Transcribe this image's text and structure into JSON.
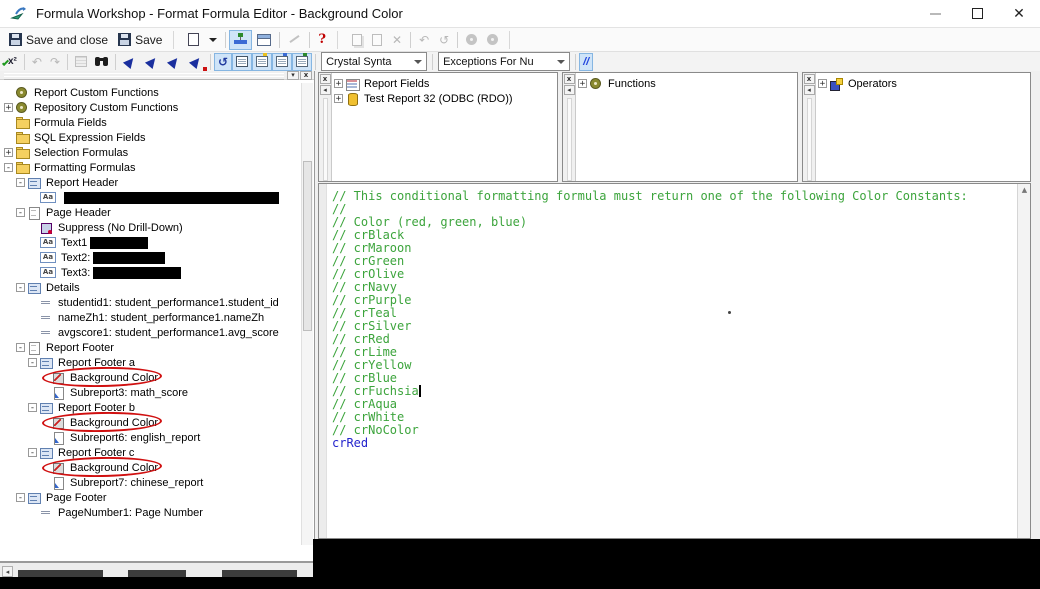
{
  "window": {
    "title": "Formula Workshop - Format Formula Editor - Background Color"
  },
  "toolbar_main": {
    "save_and_close": "Save and close",
    "save": "Save",
    "help": "?"
  },
  "toolbar_formula": {
    "check_label": "x²",
    "syntax_selector": {
      "value": "Crystal Synta"
    },
    "exceptions_selector": {
      "value": "Exceptions For Nu"
    },
    "comment_label": "//"
  },
  "icon_glyphs": {
    "text_object": "Aa",
    "undo": "↶",
    "redo": "↷",
    "refresh": "↺",
    "delete": "✕",
    "close_small": "x",
    "collapse_chevron": "▾",
    "left_arrow": "◂",
    "up_arrow": "▲",
    "close_window": "✕"
  },
  "workshop_tree": {
    "items": [
      {
        "label": "Report Custom Functions",
        "level": 0,
        "expander": "",
        "icon": "gear"
      },
      {
        "label": "Repository Custom Functions",
        "level": 0,
        "expander": "plus",
        "icon": "gear"
      },
      {
        "label": "Formula Fields",
        "level": 0,
        "expander": "",
        "icon": "folder"
      },
      {
        "label": "SQL Expression Fields",
        "level": 0,
        "expander": "",
        "icon": "folder"
      },
      {
        "label": "Selection Formulas",
        "level": 0,
        "expander": "plus",
        "icon": "folder"
      },
      {
        "label": "Formatting Formulas",
        "level": 0,
        "expander": "minus",
        "icon": "folder"
      },
      {
        "label": "Report Header",
        "level": 1,
        "expander": "minus",
        "icon": "section"
      },
      {
        "label": "",
        "level": 2,
        "expander": "",
        "icon": "text",
        "redact": 215
      },
      {
        "label": "Page Header",
        "level": 1,
        "expander": "minus",
        "icon": "page"
      },
      {
        "label": "Suppress (No Drill-Down)",
        "level": 2,
        "expander": "",
        "icon": "suppress"
      },
      {
        "label": "Text1",
        "level": 2,
        "expander": "",
        "icon": "text",
        "redact": 58
      },
      {
        "label": "Text2:",
        "level": 2,
        "expander": "",
        "icon": "text",
        "redact": 72
      },
      {
        "label": "Text3:",
        "level": 2,
        "expander": "",
        "icon": "text",
        "redact": 88
      },
      {
        "label": "Details",
        "level": 1,
        "expander": "minus",
        "icon": "section"
      },
      {
        "label": "studentid1: student_performance1.student_id",
        "level": 2,
        "expander": "",
        "icon": "dash"
      },
      {
        "label": "nameZh1: student_performance1.nameZh",
        "level": 2,
        "expander": "",
        "icon": "dash"
      },
      {
        "label": "avgscore1: student_performance1.avg_score",
        "level": 2,
        "expander": "",
        "icon": "dash"
      },
      {
        "label": "Report Footer",
        "level": 1,
        "expander": "minus",
        "icon": "page"
      },
      {
        "label": "Report Footer a",
        "level": 2,
        "expander": "minus",
        "icon": "section"
      },
      {
        "label": "Background Color",
        "level": 3,
        "expander": "",
        "icon": "format",
        "circled": true
      },
      {
        "label": "Subreport3: math_score",
        "level": 3,
        "expander": "",
        "icon": "subreport"
      },
      {
        "label": "Report Footer b",
        "level": 2,
        "expander": "minus",
        "icon": "section"
      },
      {
        "label": "Background Color",
        "level": 3,
        "expander": "",
        "icon": "format",
        "circled": true
      },
      {
        "label": "Subreport6: english_report",
        "level": 3,
        "expander": "",
        "icon": "subreport"
      },
      {
        "label": "Report Footer c",
        "level": 2,
        "expander": "minus",
        "icon": "section"
      },
      {
        "label": "Background Color",
        "level": 3,
        "expander": "",
        "icon": "format",
        "circled": true
      },
      {
        "label": "Subreport7: chinese_report",
        "level": 3,
        "expander": "",
        "icon": "subreport"
      },
      {
        "label": "Page Footer",
        "level": 1,
        "expander": "minus",
        "icon": "section"
      },
      {
        "label": "PageNumber1: Page Number",
        "level": 2,
        "expander": "",
        "icon": "dash"
      }
    ]
  },
  "fields_panel": {
    "items": [
      {
        "label": "Report Fields",
        "icon": "report-fields"
      },
      {
        "label": "Test Report 32 (ODBC (RDO))",
        "icon": "db"
      }
    ]
  },
  "functions_panel": {
    "items": [
      {
        "label": "Functions",
        "icon": "gear"
      }
    ]
  },
  "operators_panel": {
    "items": [
      {
        "label": "Operators",
        "icon": "operators"
      }
    ]
  },
  "editor": {
    "comment_lines": [
      "// This conditional formatting formula must return one of the following Color Constants:",
      "//",
      "// Color (red, green, blue)",
      "// crBlack",
      "// crMaroon",
      "// crGreen",
      "// crOlive",
      "// crNavy",
      "// crPurple",
      "// crTeal",
      "// crSilver",
      "// crRed",
      "// crLime",
      "// crYellow",
      "// crBlue",
      "// crFuchsia",
      "// crAqua",
      "// crWhite",
      "// crNoColor"
    ],
    "code_line": "crRed",
    "cursor_line_index": 15,
    "comment_color": "#3ca43c",
    "code_color": "#2424cc"
  },
  "colors": {
    "annotation_red": "#d01010",
    "toggle_blue_bg": "#cfe4f8",
    "redaction_black": "#000000"
  }
}
